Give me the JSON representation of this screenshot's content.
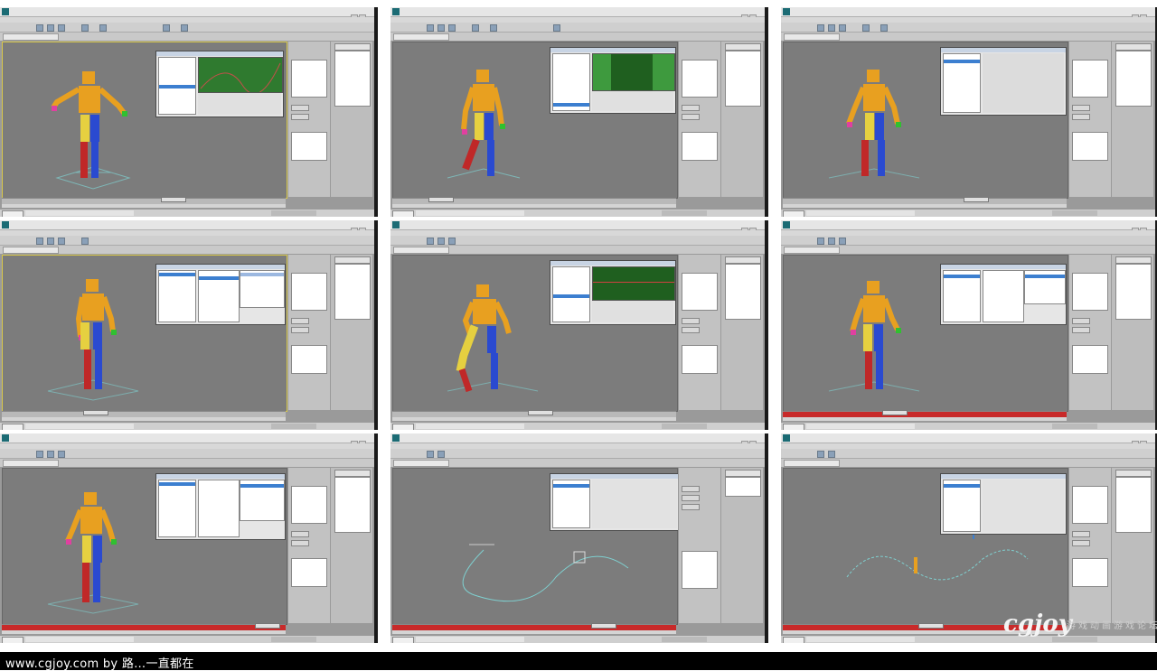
{
  "bottom_bar": {
    "text": "www.cgjoy.com by 路…一直都在"
  },
  "watermark": {
    "logo_text": "cgjoy",
    "cn_text": "游戏动画游戏论坛"
  },
  "colors": {
    "timeline_red": "#c82a2a",
    "viewport_bg": "#7c7c7c",
    "graph_green": "#2f7a2f",
    "selection_blue": "#3c7fd0",
    "figure_orange": "#e8a020",
    "figure_blue": "#2a4ad0",
    "figure_red": "#c02828",
    "figure_yellow": "#e6d040"
  },
  "panels": [
    {
      "id": "p1",
      "dialog": "graph"
    },
    {
      "id": "p2",
      "dialog": "green"
    },
    {
      "id": "p3",
      "dialog": "fields"
    },
    {
      "id": "p4",
      "dialog": "list"
    },
    {
      "id": "p5",
      "dialog": "graph2"
    },
    {
      "id": "p6",
      "dialog": "list"
    },
    {
      "id": "p7",
      "dialog": "list"
    },
    {
      "id": "p8",
      "dialog": "path"
    },
    {
      "id": "p9",
      "dialog": "path2"
    }
  ]
}
